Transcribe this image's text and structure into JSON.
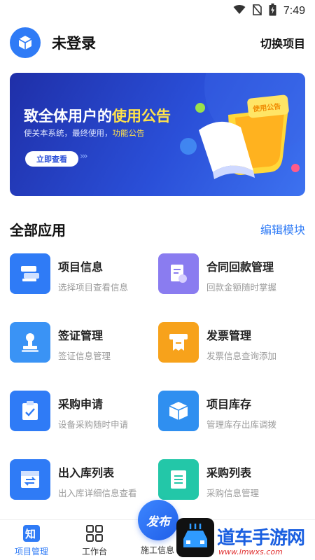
{
  "status_bar": {
    "time": "7:49"
  },
  "header": {
    "login_status": "未登录",
    "switch_project": "切换项目"
  },
  "banner": {
    "title_prefix": "致全体用户的",
    "title_highlight": "使用公告",
    "subtitle_prefix": "使关本系统，最终使用，",
    "subtitle_highlight": "功能公告",
    "button": "立即查看",
    "badge": "使用公告"
  },
  "section": {
    "title": "全部应用",
    "edit": "编辑模块"
  },
  "apps": [
    {
      "name": "项目信息",
      "desc": "选择项目查看信息",
      "icon": "project-info-icon",
      "color": "#2f7bf6"
    },
    {
      "name": "合同回款管理",
      "desc": "回款金额随时掌握",
      "icon": "contract-payment-icon",
      "color": "#8a7cf0"
    },
    {
      "name": "签证管理",
      "desc": "签证信息管理",
      "icon": "visa-stamp-icon",
      "color": "#3a93f5"
    },
    {
      "name": "发票管理",
      "desc": "发票信息查询添加",
      "icon": "invoice-icon",
      "color": "#f7a21b"
    },
    {
      "name": "采购申请",
      "desc": "设备采购随时申请",
      "icon": "purchase-request-icon",
      "color": "#2f7bf6"
    },
    {
      "name": "项目库存",
      "desc": "管理库存出库调拨",
      "icon": "inventory-box-icon",
      "color": "#2f8ff0"
    },
    {
      "name": "出入库列表",
      "desc": "出入库详细信息查看",
      "icon": "in-out-list-icon",
      "color": "#2f7bf6"
    },
    {
      "name": "采购列表",
      "desc": "采购信息管理",
      "icon": "purchase-list-icon",
      "color": "#23c7a8"
    }
  ],
  "bottom_nav": {
    "items": [
      {
        "label": "项目管理",
        "icon_text": "知"
      },
      {
        "label": "工作台"
      },
      {
        "label": "施工信息"
      }
    ],
    "publish": "发布"
  },
  "watermark": {
    "text": "道车手游网",
    "url": "www.lmwxs.com"
  }
}
